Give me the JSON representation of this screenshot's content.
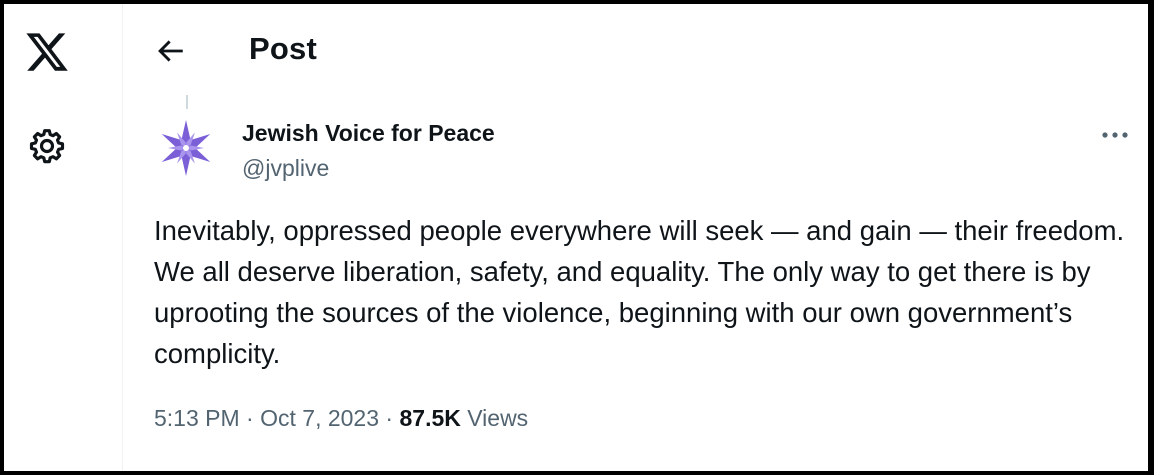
{
  "header": {
    "title": "Post",
    "back_icon": "arrow-left-icon"
  },
  "sidebar": {
    "logo_icon": "x-logo-icon",
    "settings_icon": "gear-icon"
  },
  "post": {
    "author": {
      "display_name": "Jewish Voice for Peace",
      "handle": "@jvplive",
      "avatar_icon": "star-of-david-logo",
      "avatar_color": "#7b5fd6"
    },
    "text": "Inevitably, oppressed people everywhere will seek — and gain — their freedom. We all deserve liberation, safety, and equality. The only way to get there is by uprooting the sources of the violence, beginning with our own government’s complicity.",
    "time": "5:13 PM",
    "separator": "·",
    "date": "Oct 7, 2023",
    "views_count": "87.5K",
    "views_label": "Views",
    "more_icon": "more-horizontal-icon"
  },
  "colors": {
    "text_primary": "#0f1419",
    "text_secondary": "#536471",
    "divider": "#eff3f4"
  }
}
